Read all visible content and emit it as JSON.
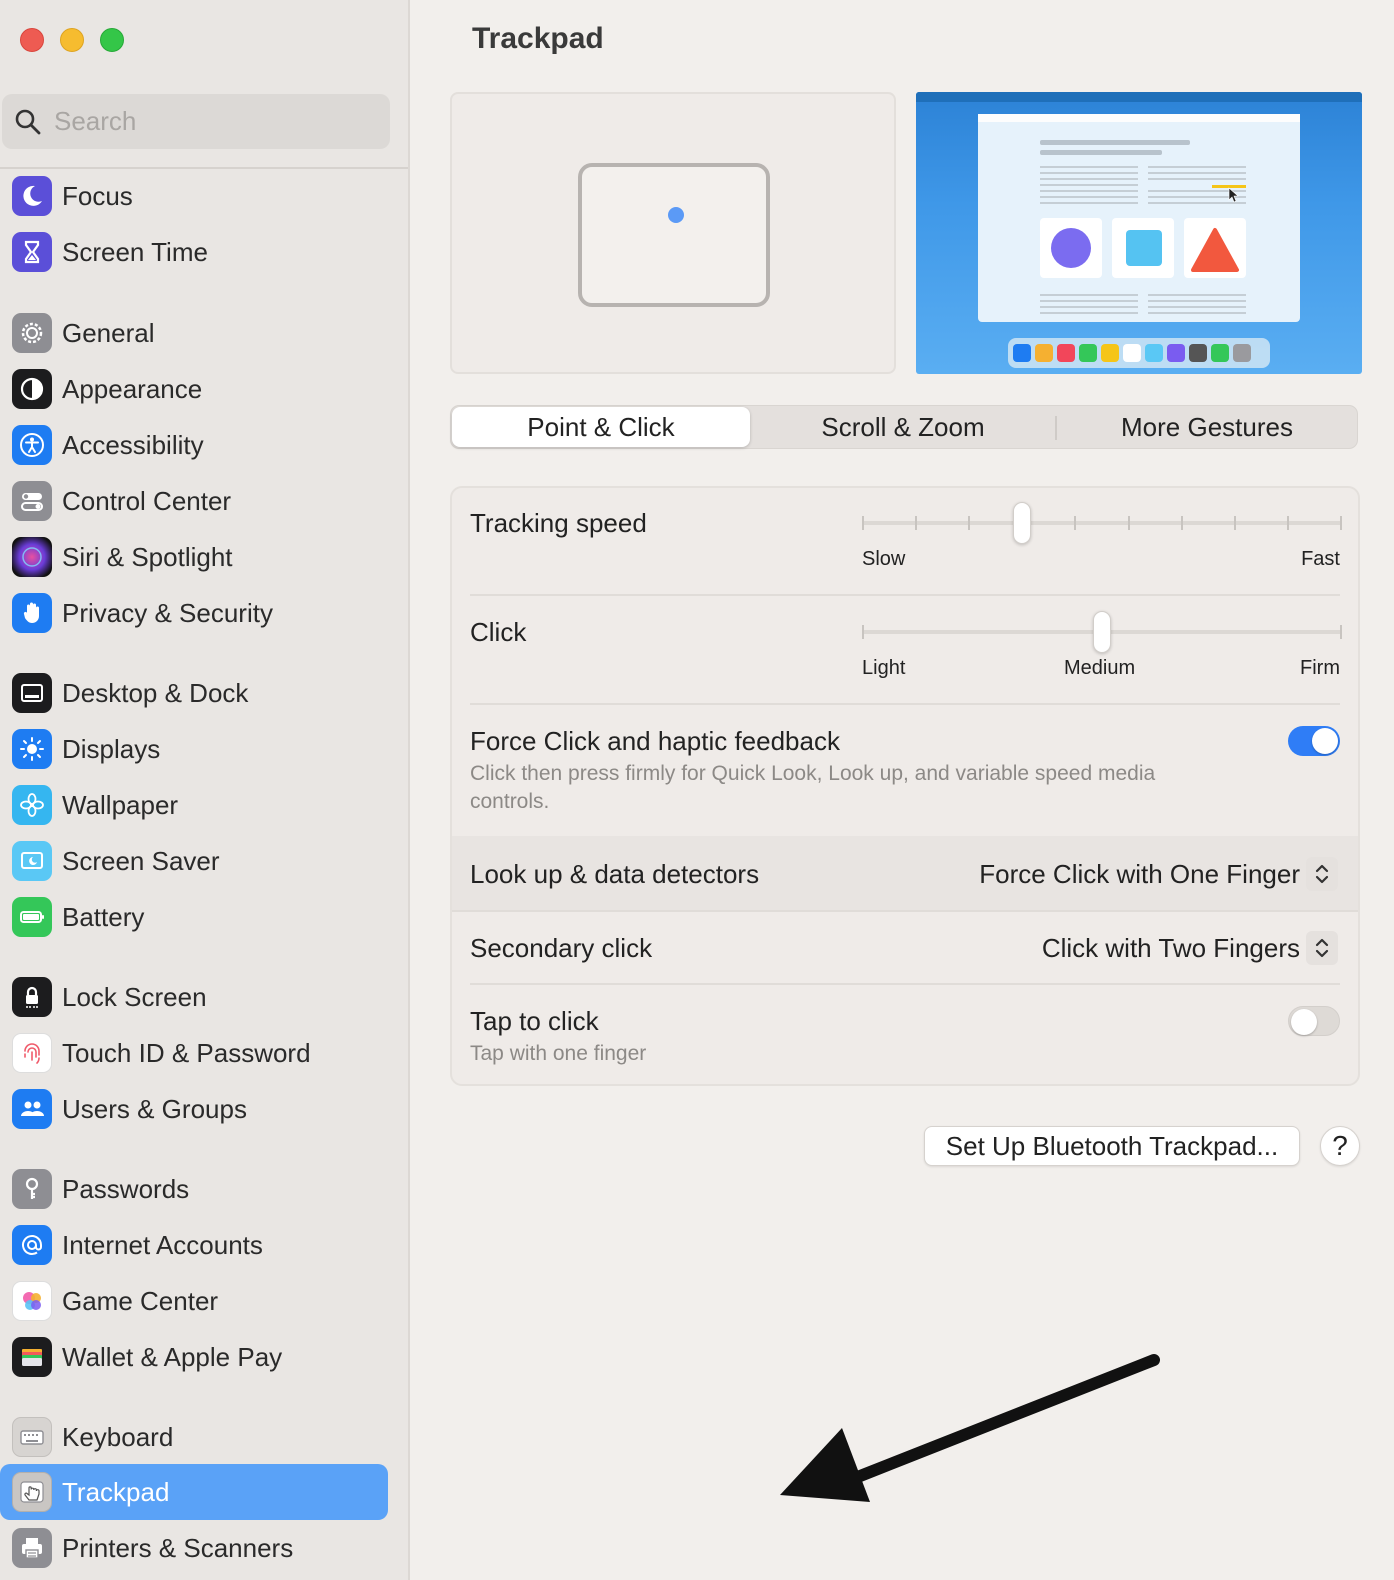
{
  "window": {
    "title": "Trackpad"
  },
  "search": {
    "placeholder": "Search"
  },
  "sidebar": {
    "items": [
      {
        "label": "Focus",
        "icon": "moon-icon",
        "color": "#5b4fd8"
      },
      {
        "label": "Screen Time",
        "icon": "hourglass-icon",
        "color": "#5b4fd8"
      },
      {
        "label": "General",
        "icon": "gear-icon",
        "color": "#8e8e93"
      },
      {
        "label": "Appearance",
        "icon": "appearance-icon",
        "color": "#1c1c1e"
      },
      {
        "label": "Accessibility",
        "icon": "accessibility-icon",
        "color": "#1e7cf2"
      },
      {
        "label": "Control Center",
        "icon": "control-center-icon",
        "color": "#8e8e93"
      },
      {
        "label": "Siri & Spotlight",
        "icon": "siri-icon",
        "color": "#2a2a6a"
      },
      {
        "label": "Privacy & Security",
        "icon": "hand-icon",
        "color": "#1e7cf2"
      },
      {
        "label": "Desktop & Dock",
        "icon": "dock-icon",
        "color": "#1c1c1e"
      },
      {
        "label": "Displays",
        "icon": "sun-icon",
        "color": "#1e7cf2"
      },
      {
        "label": "Wallpaper",
        "icon": "flower-icon",
        "color": "#35b6f0"
      },
      {
        "label": "Screen Saver",
        "icon": "screen-saver-icon",
        "color": "#5ac8f5"
      },
      {
        "label": "Battery",
        "icon": "battery-icon",
        "color": "#34c759"
      },
      {
        "label": "Lock Screen",
        "icon": "lock-icon",
        "color": "#1c1c1e"
      },
      {
        "label": "Touch ID & Password",
        "icon": "fingerprint-icon",
        "color": "#ffffff"
      },
      {
        "label": "Users & Groups",
        "icon": "users-icon",
        "color": "#1e7cf2"
      },
      {
        "label": "Passwords",
        "icon": "key-icon",
        "color": "#8e8e93"
      },
      {
        "label": "Internet Accounts",
        "icon": "at-icon",
        "color": "#1e7cf2"
      },
      {
        "label": "Game Center",
        "icon": "game-center-icon",
        "color": "#ffffff"
      },
      {
        "label": "Wallet & Apple Pay",
        "icon": "wallet-icon",
        "color": "#1c1c1e"
      },
      {
        "label": "Keyboard",
        "icon": "keyboard-icon",
        "color": "#8e8e93"
      },
      {
        "label": "Trackpad",
        "icon": "trackpad-icon",
        "color": "#8e8e93",
        "active": true
      },
      {
        "label": "Printers & Scanners",
        "icon": "printer-icon",
        "color": "#8e8e93"
      }
    ]
  },
  "tabs": [
    {
      "label": "Point & Click",
      "active": true
    },
    {
      "label": "Scroll & Zoom",
      "active": false
    },
    {
      "label": "More Gestures",
      "active": false
    }
  ],
  "settings": {
    "tracking": {
      "label": "Tracking speed",
      "min_label": "Slow",
      "max_label": "Fast",
      "ticks": 10,
      "value_index": 3
    },
    "click": {
      "label": "Click",
      "labels": [
        "Light",
        "Medium",
        "Firm"
      ],
      "value_index": 1
    },
    "force_click": {
      "label": "Force Click and haptic feedback",
      "description": "Click then press firmly for Quick Look, Look up, and variable speed media controls.",
      "enabled": true
    },
    "lookup": {
      "label": "Look up & data detectors",
      "value": "Force Click with One Finger"
    },
    "secondary": {
      "label": "Secondary click",
      "value": "Click with Two Fingers"
    },
    "tap": {
      "label": "Tap to click",
      "description": "Tap with one finger",
      "enabled": false
    }
  },
  "buttons": {
    "bluetooth": "Set Up Bluetooth Trackpad...",
    "help": "?"
  },
  "colors": {
    "accent": "#2f7df6",
    "sidebar_selected": "#5aa2f7"
  }
}
